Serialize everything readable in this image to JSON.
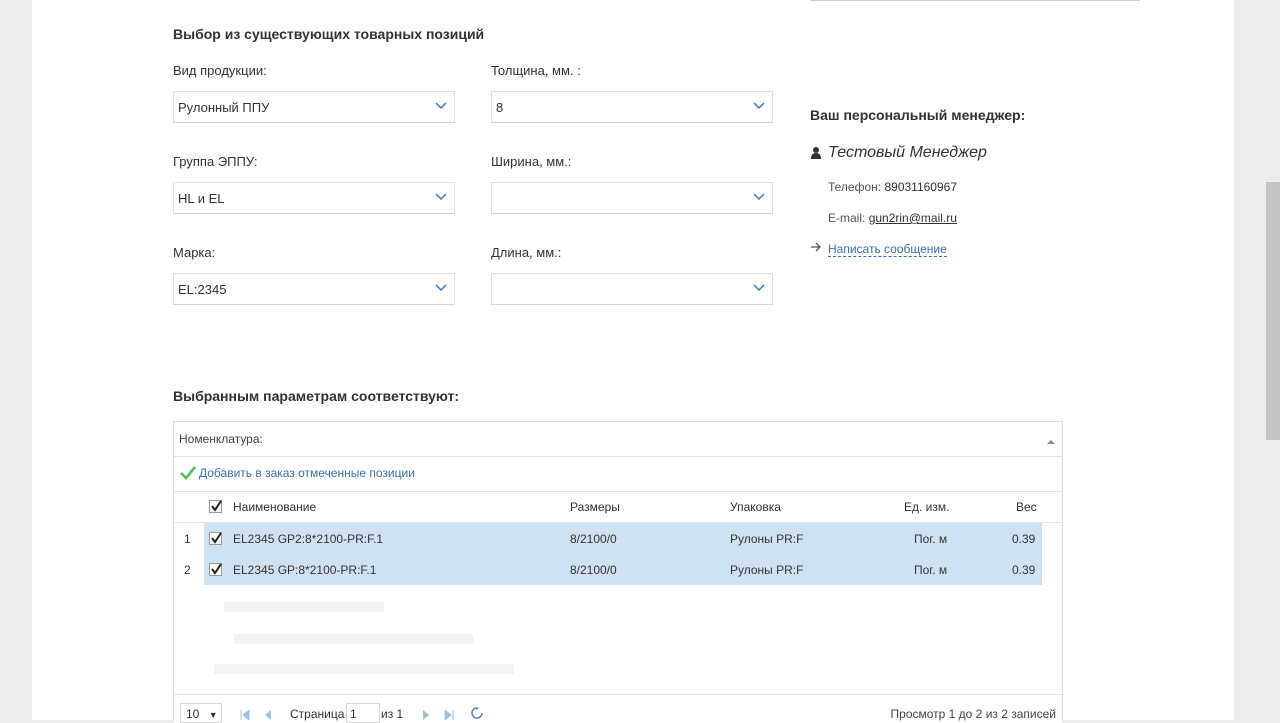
{
  "selection_section": {
    "title": "Выбор из существующих товарных позиций",
    "product_type": {
      "label": "Вид продукции:",
      "value": "Рулонный ППУ"
    },
    "group": {
      "label": "Группа ЭППУ:",
      "value": "HL и EL"
    },
    "brand": {
      "label": "Марка:",
      "value": "EL:2345"
    },
    "thickness": {
      "label": "Толщина, мм. :",
      "value": "8"
    },
    "width": {
      "label": "Ширина, мм.:",
      "value": ""
    },
    "length": {
      "label": "Длина, мм.:",
      "value": ""
    }
  },
  "manager": {
    "title": "Ваш персональный менеджер:",
    "name": "Тестовый Менеджер",
    "phone_label": "Телефон:",
    "phone": "89031160967",
    "email_label": "E-mail:",
    "email": "gun2rin@mail.ru",
    "message_link": "Написать сообщение"
  },
  "results": {
    "title": "Выбранным параметрам соответствуют:",
    "grid_caption": "Номенклатура:",
    "add_button": "Добавить в заказ отмеченные позиции",
    "columns": [
      "Наименование",
      "Размеры",
      "Упаковка",
      "Ед. изм.",
      "Вес"
    ],
    "rows": [
      {
        "num": "1",
        "name": "EL2345 GP2:8*2100-PR:F.1",
        "size": "8/2100/0",
        "pack": "Рулоны PR:F",
        "unit": "Пог. м",
        "weight": "0.39"
      },
      {
        "num": "2",
        "name": "EL2345 GP:8*2100-PR:F.1",
        "size": "8/2100/0",
        "pack": "Рулоны PR:F",
        "unit": "Пог. м",
        "weight": "0.39"
      }
    ],
    "pager": {
      "page_size": "10",
      "page_label": "Страница",
      "page": "1",
      "of_label": "из 1",
      "info": "Просмотр 1 до 2 из 2 записей"
    }
  },
  "colors": {
    "row_selected": "#cfe2f3",
    "link": "#3a6ea5",
    "check": "#5cb85c"
  }
}
